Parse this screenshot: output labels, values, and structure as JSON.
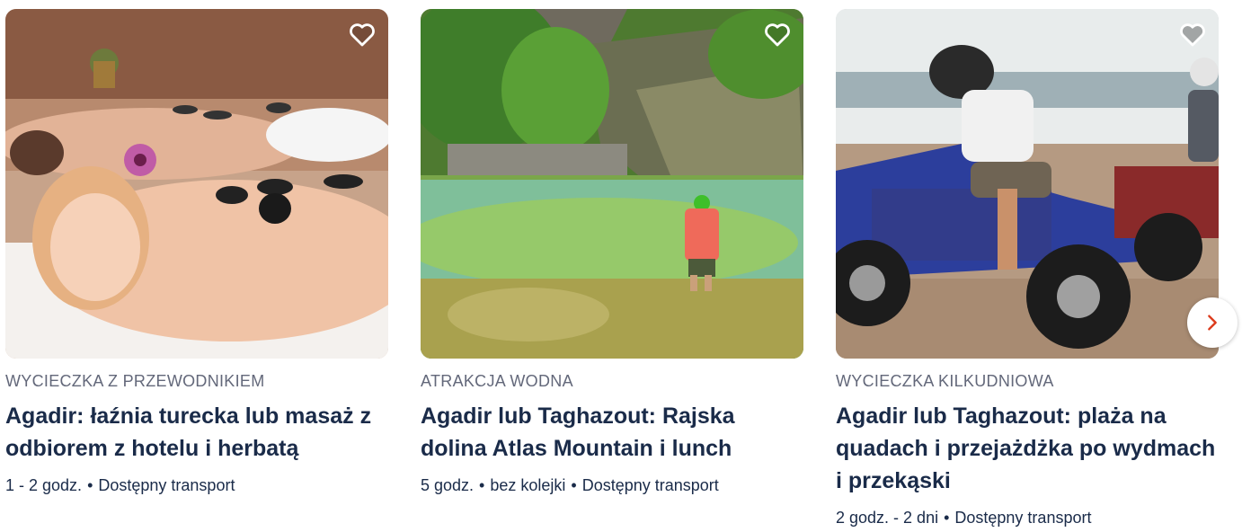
{
  "cards": [
    {
      "category": "Wycieczka z przewodnikiem",
      "title": "Agadir: łaźnia turecka lub masaż z odbiorem z hotelu i herbatą",
      "duration": "1 - 2 godz.",
      "features": [
        "Dostępny transport"
      ],
      "favorite_icon": "heart-outline-icon"
    },
    {
      "category": "Atrakcja wodna",
      "title": "Agadir lub Taghazout: Rajska dolina Atlas Mountain i lunch",
      "duration": "5 godz.",
      "features": [
        "bez kolejki",
        "Dostępny transport"
      ],
      "favorite_icon": "heart-outline-icon"
    },
    {
      "category": "Wycieczka kilkudniowa",
      "title": "Agadir lub Taghazout: plaża na quadach i przejażdżka po wydmach i przekąski",
      "duration": "2 godz. - 2 dni",
      "features": [
        "Dostępny transport"
      ],
      "favorite_icon": "heart-outline-icon"
    }
  ],
  "carousel": {
    "next_icon": "chevron-right-icon"
  },
  "colors": {
    "text": "#1a2b49",
    "category": "#63687a",
    "accent": "#dc3a1b"
  }
}
